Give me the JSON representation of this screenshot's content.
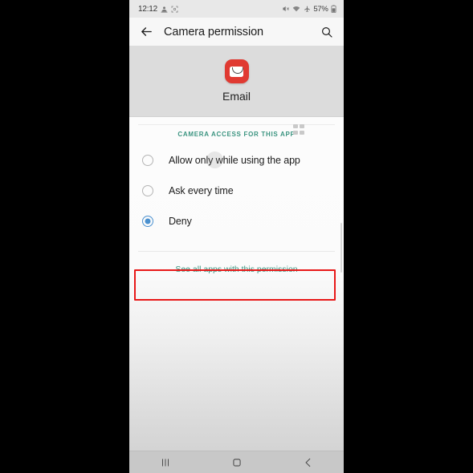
{
  "statusbar": {
    "time": "12:12",
    "left_icons": [
      "contact-sync-icon",
      "scan-icon"
    ],
    "right_icons": [
      "mute-icon",
      "wifi-icon",
      "airplane-mode-icon"
    ],
    "battery": "57%",
    "battery_icon": "battery-icon"
  },
  "actionbar": {
    "back_icon": "back-arrow-icon",
    "title": "Camera permission",
    "search_icon": "search-icon"
  },
  "app": {
    "icon": "email-app-icon",
    "name": "Email"
  },
  "section": {
    "label": "CAMERA ACCESS FOR THIS APP",
    "grid_icon": "grid-2x2-icon"
  },
  "options": [
    {
      "label": "Allow only while using the app",
      "selected": false,
      "highlighted": true
    },
    {
      "label": "Ask every time",
      "selected": false,
      "highlighted": false
    },
    {
      "label": "Deny",
      "selected": true,
      "highlighted": false
    }
  ],
  "footer": {
    "link": "See all apps with this permission"
  },
  "navbar": {
    "recents_icon": "recents-icon",
    "home_icon": "home-icon",
    "back_icon": "back-icon"
  },
  "colors": {
    "accent_teal": "#3b9480",
    "radio_blue": "#4a90cf",
    "highlight_red": "#e81818",
    "app_icon_red": "#e03a32"
  }
}
